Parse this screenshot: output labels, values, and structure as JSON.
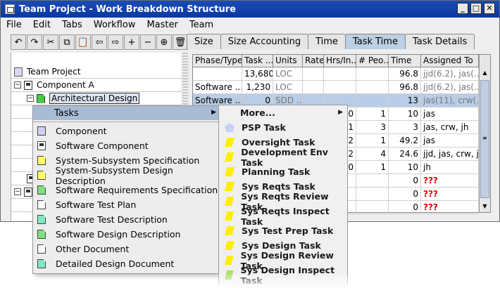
{
  "window": {
    "title": "Team Project - Work Breakdown Structure"
  },
  "menubar": [
    "File",
    "Edit",
    "Tabs",
    "Workflow",
    "Master",
    "Team"
  ],
  "toolbar": [
    {
      "name": "undo-icon",
      "glyph": "↶"
    },
    {
      "name": "redo-icon",
      "glyph": "↷"
    },
    {
      "name": "cut-icon",
      "glyph": "✂"
    },
    {
      "name": "copy-icon",
      "glyph": "⧉"
    },
    {
      "name": "paste-icon",
      "glyph": "📋"
    },
    {
      "name": "move-left-icon",
      "glyph": "⇦"
    },
    {
      "name": "move-right-icon",
      "glyph": "⇨"
    },
    {
      "name": "add-icon",
      "glyph": "+"
    },
    {
      "name": "remove-icon",
      "glyph": "−"
    },
    {
      "name": "insert-icon",
      "glyph": "⊕"
    },
    {
      "name": "delete-icon",
      "glyph": "🗑"
    }
  ],
  "tabs": [
    "Size",
    "Size Accounting",
    "Time",
    "Task Time",
    "Task Details"
  ],
  "tree": {
    "root": "Team Project",
    "component": "Component A",
    "selected": "Architectural Design"
  },
  "grid": {
    "headers": [
      "Phase/Type",
      "Task ...",
      "Units",
      "Rate",
      "Hrs/In...",
      "# Peo...",
      "Time",
      "Assigned To"
    ],
    "rows": [
      [
        "",
        "13,680",
        "LOC",
        "",
        "",
        "",
        "96.8",
        "jjd(6.2), jas(..."
      ],
      [
        "Software ...",
        "1,230",
        "LOC",
        "",
        "",
        "",
        "96.8",
        "jjd(6.2), jas(..."
      ],
      [
        "Software ...",
        "0",
        "SDD ...",
        "",
        "",
        "",
        "13",
        "jas(11), crw(..."
      ],
      [
        "",
        "",
        "",
        "",
        "0",
        "1",
        "10",
        "jas"
      ],
      [
        "",
        "",
        "",
        "",
        "1",
        "3",
        "3",
        "jas, crw, jh"
      ],
      [
        "",
        "",
        "",
        "",
        "2",
        "1",
        "49.2",
        "jas"
      ],
      [
        "",
        "",
        "",
        "",
        "2",
        "4",
        "24.6",
        "jjd, jas, crw, jh"
      ],
      [
        "",
        "",
        "",
        "",
        "0",
        "1",
        "10",
        "jh"
      ],
      [
        "",
        "",
        "",
        "",
        "",
        "",
        "0",
        "???"
      ],
      [
        "",
        "",
        "",
        "",
        "",
        "",
        "0",
        "???"
      ],
      [
        "",
        "",
        "",
        "",
        "",
        "",
        "0",
        "???"
      ]
    ]
  },
  "context_menu": {
    "header": "Tasks",
    "items": [
      "Component",
      "Software Component",
      "System-Subsystem Specification",
      "System-Subsystem Design Description",
      "Software Requirements Specification",
      "Software Test Plan",
      "Software Test Description",
      "Software Design Description",
      "Other Document",
      "Detailed Design Document"
    ]
  },
  "submenu": {
    "more": "More...",
    "items": [
      "PSP Task",
      "Oversight Task",
      "Development Env Task",
      "Planning Task",
      "Sys Reqts Task",
      "Sys Reqts Review Task",
      "Sys Reqts Inspect Task",
      "Sys Test Prep Task",
      "Sys Design Task",
      "Sys Design Review Task",
      "Sys Design Inspect Task"
    ]
  }
}
